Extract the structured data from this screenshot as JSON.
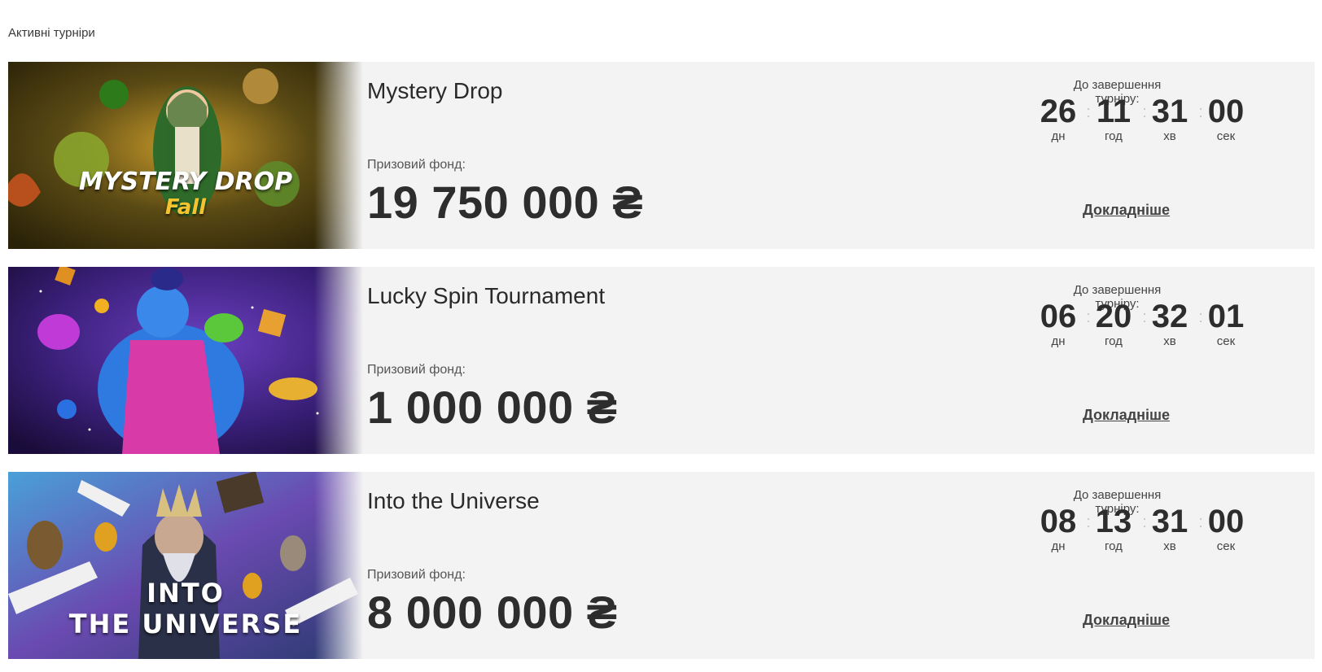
{
  "section_title": "Активні турніри",
  "tournaments": [
    {
      "name": "Mystery Drop",
      "banner_text": "MYSTERY DROP",
      "banner_subtext": "Fall",
      "fund_label": "Призовий фонд:",
      "fund_value": "19 750 000 ₴",
      "timer_label": "До завершення турніру:",
      "timer": {
        "days": "26",
        "hours": "11",
        "minutes": "31",
        "seconds": "00"
      },
      "timer_units": {
        "days": "дн",
        "hours": "год",
        "minutes": "хв",
        "seconds": "сек"
      },
      "more_label": "Докладніше"
    },
    {
      "name": "Lucky Spin Tournament",
      "banner_text": "",
      "banner_subtext": "",
      "fund_label": "Призовий фонд:",
      "fund_value": "1 000 000 ₴",
      "timer_label": "До завершення турніру:",
      "timer": {
        "days": "06",
        "hours": "20",
        "minutes": "32",
        "seconds": "01"
      },
      "timer_units": {
        "days": "дн",
        "hours": "год",
        "minutes": "хв",
        "seconds": "сек"
      },
      "more_label": "Докладніше"
    },
    {
      "name": "Into the Universe",
      "banner_text": "INTO",
      "banner_subtext": "THE UNIVERSE",
      "fund_label": "Призовий фонд:",
      "fund_value": "8 000 000 ₴",
      "timer_label": "До завершення турніру:",
      "timer": {
        "days": "08",
        "hours": "13",
        "minutes": "31",
        "seconds": "00"
      },
      "timer_units": {
        "days": "дн",
        "hours": "год",
        "minutes": "хв",
        "seconds": "сек"
      },
      "more_label": "Докладніше"
    }
  ],
  "colors": {
    "card_bg": "#f3f3f3",
    "text_dark": "#2d2d2d",
    "banner_1": "#4a3a12",
    "banner_2": "#3a1f78",
    "banner_3": "#2a5a8a"
  }
}
